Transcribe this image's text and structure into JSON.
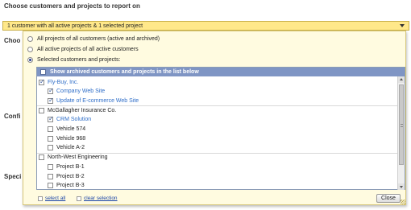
{
  "page": {
    "heading": "Choose customers and projects to report on",
    "bg_label_1": "Choo",
    "bg_label_2": "Confi",
    "bg_label_3": "Speci"
  },
  "select": {
    "value": "1 customer with all active projects & 1 selected project"
  },
  "options": [
    {
      "label": "All projects of all customers (active and archived)",
      "checked": false
    },
    {
      "label": "All active projects of all active customers",
      "checked": false
    },
    {
      "label": "Selected customers and projects:",
      "checked": true
    }
  ],
  "list": {
    "header_label": "Show archived customers and projects in the list below",
    "rows": [
      {
        "type": "customer",
        "label": "Fly-Buy, Inc.",
        "checked": true,
        "color": "blue"
      },
      {
        "type": "project",
        "label": "Company Web Site",
        "checked": true,
        "color": "blue"
      },
      {
        "type": "project",
        "label": "Update of E-commerce Web Site",
        "checked": true,
        "color": "blue"
      },
      {
        "type": "customer",
        "label": "McGallagher Insurance Co.",
        "checked": false,
        "color": "dark"
      },
      {
        "type": "project",
        "label": "CRM Solution",
        "checked": true,
        "color": "blue"
      },
      {
        "type": "project",
        "label": "Vehicle 574",
        "checked": false,
        "color": "dark"
      },
      {
        "type": "project",
        "label": "Vehicle 968",
        "checked": false,
        "color": "dark"
      },
      {
        "type": "project",
        "label": "Vehicle A-2",
        "checked": false,
        "color": "dark"
      },
      {
        "type": "customer",
        "label": "North-West Engineering",
        "checked": false,
        "color": "dark"
      },
      {
        "type": "project",
        "label": "Project B-1",
        "checked": false,
        "color": "dark"
      },
      {
        "type": "project",
        "label": "Project B-2",
        "checked": false,
        "color": "dark"
      },
      {
        "type": "project",
        "label": "Project B-3",
        "checked": false,
        "color": "dark"
      }
    ]
  },
  "footer": {
    "select_all": "select all",
    "clear_selection": "clear selection",
    "close": "Close"
  },
  "colors": {
    "select_bar": "#ffe88a",
    "panel_bg": "#fffbe0",
    "list_header": "#7f95c4",
    "link_blue": "#2f6ec8"
  }
}
